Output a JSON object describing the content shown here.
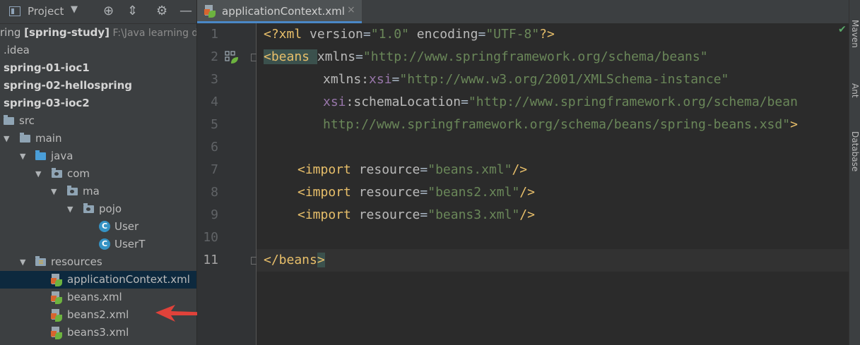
{
  "project_panel": {
    "title": "Project",
    "tree": [
      {
        "id": "root",
        "prefix": "ring ",
        "bold": "[spring-study]",
        "path": "  F:\\Java learning do"
      },
      {
        "id": "idea",
        "label": ".idea"
      },
      {
        "id": "m1",
        "label": "spring-01-ioc1"
      },
      {
        "id": "m2",
        "label": "spring-02-hellospring"
      },
      {
        "id": "m3",
        "label": "spring-03-ioc2"
      },
      {
        "id": "src",
        "label": "src"
      },
      {
        "id": "main",
        "label": "main"
      },
      {
        "id": "java",
        "label": "java"
      },
      {
        "id": "com",
        "label": "com"
      },
      {
        "id": "ma",
        "label": "ma"
      },
      {
        "id": "pojo",
        "label": "pojo"
      },
      {
        "id": "user",
        "label": "User"
      },
      {
        "id": "usert",
        "label": "UserT"
      },
      {
        "id": "resources",
        "label": "resources"
      },
      {
        "id": "appctx",
        "label": "applicationContext.xml"
      },
      {
        "id": "beans",
        "label": "beans.xml"
      },
      {
        "id": "beans2",
        "label": "beans2.xml"
      },
      {
        "id": "beans3",
        "label": "beans3.xml"
      }
    ]
  },
  "editor": {
    "tab_label": "applicationContext.xml",
    "close_glyph": "×",
    "line_numbers": [
      "1",
      "2",
      "3",
      "4",
      "5",
      "6",
      "7",
      "8",
      "9",
      "10",
      "11"
    ],
    "lines": {
      "l1": [
        "<?xml ",
        "version",
        "=",
        "\"1.0\"",
        " encoding",
        "=",
        "\"UTF-8\"",
        "?>"
      ],
      "l2": [
        "<beans ",
        "xmlns",
        "=",
        "\"http://www.springframework.org/schema/beans\""
      ],
      "l3": [
        "xmlns:",
        "xsi",
        "=",
        "\"http://www.w3.org/2001/XMLSchema-instance\""
      ],
      "l4": [
        "xsi",
        ":schemaLocation",
        "=",
        "\"http://www.springframework.org/schema/bean"
      ],
      "l5": [
        "http://www.springframework.org/schema/beans/spring-beans.xsd\"",
        ">"
      ],
      "l7": [
        "<import ",
        "resource",
        "=",
        "\"beans.xml\"",
        "/>"
      ],
      "l8": [
        "<import ",
        "resource",
        "=",
        "\"beans2.xml\"",
        "/>"
      ],
      "l9": [
        "<import ",
        "resource",
        "=",
        "\"beans3.xml\"",
        "/>"
      ],
      "l11": [
        "</beans",
        ">"
      ]
    }
  },
  "right_toolbar": [
    "Maven",
    "Ant",
    "Database"
  ],
  "colors": {
    "accent": "#4a88c7",
    "selection": "#0d293e",
    "arrow": "#e0423a",
    "string": "#6a8759",
    "tag": "#e8bf6a"
  }
}
